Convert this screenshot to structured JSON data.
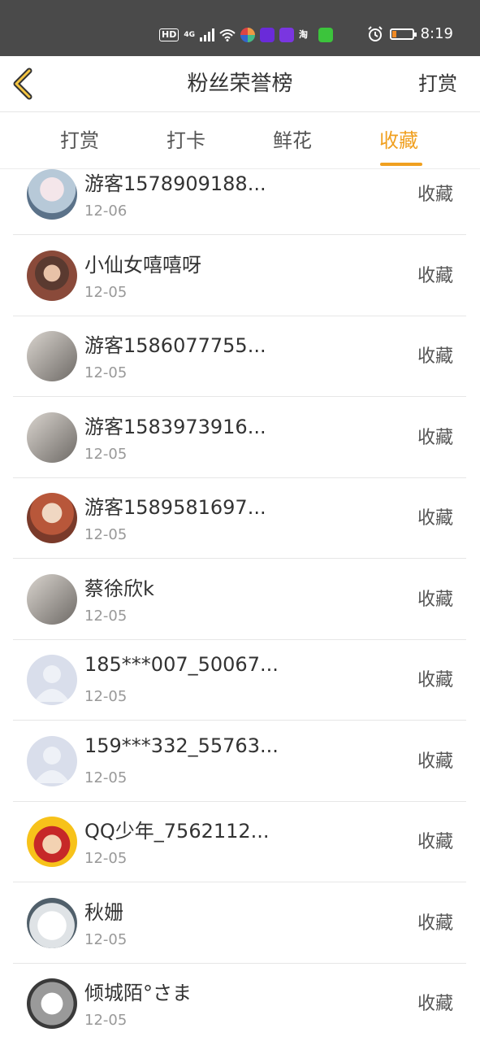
{
  "status_bar": {
    "indicators": [
      "HD",
      "4G"
    ],
    "time": "8:19",
    "battery_level": 0.2,
    "icons": [
      "hd-icon",
      "signal-icon",
      "wifi-icon",
      "app-icon",
      "video-app-icon",
      "video-app-icon",
      "taobao-icon",
      "iqiyi-icon",
      "alarm-icon",
      "battery-icon"
    ]
  },
  "header": {
    "title": "粉丝荣誉榜",
    "action_label": "打赏",
    "back_icon": "chevron-left-icon"
  },
  "tabs": [
    {
      "label": "打赏",
      "active": false
    },
    {
      "label": "打卡",
      "active": false
    },
    {
      "label": "鲜花",
      "active": false
    },
    {
      "label": "收藏",
      "active": true
    }
  ],
  "colors": {
    "accent": "#f0a020",
    "status_bar": "#4a4a4a"
  },
  "fans": [
    {
      "name": "游客1578909188...",
      "date": "12-06",
      "action": "收藏",
      "avatar": "anime-girl-avatar"
    },
    {
      "name": "小仙女嘻嘻呀",
      "date": "12-05",
      "action": "收藏",
      "avatar": "girl-avatar"
    },
    {
      "name": "游客1586077755...",
      "date": "12-05",
      "action": "收藏",
      "avatar": "photo-avatar"
    },
    {
      "name": "游客1583973916...",
      "date": "12-05",
      "action": "收藏",
      "avatar": "photo-avatar"
    },
    {
      "name": "游客1589581697...",
      "date": "12-05",
      "action": "收藏",
      "avatar": "anime-avatar"
    },
    {
      "name": "蔡徐欣k",
      "date": "12-05",
      "action": "收藏",
      "avatar": "photo-avatar"
    },
    {
      "name": "185***007_50067...",
      "date": "12-05",
      "action": "收藏",
      "avatar": "default-avatar"
    },
    {
      "name": "159***332_55763...",
      "date": "12-05",
      "action": "收藏",
      "avatar": "default-avatar"
    },
    {
      "name": "QQ少年_7562112...",
      "date": "12-05",
      "action": "收藏",
      "avatar": "cartoon-boy-avatar"
    },
    {
      "name": "秋姗",
      "date": "12-05",
      "action": "收藏",
      "avatar": "bear-avatar"
    },
    {
      "name": "倾城陌°さま",
      "date": "12-05",
      "action": "收藏",
      "avatar": "sketch-avatar"
    }
  ]
}
